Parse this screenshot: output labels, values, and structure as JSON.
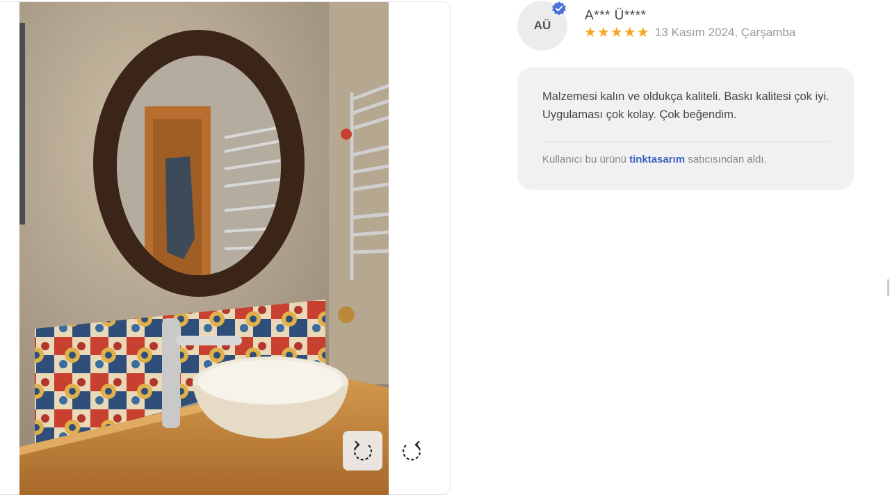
{
  "reviewer": {
    "initials": "AÜ",
    "name": "A*** Ü****",
    "rating": 5,
    "date": "13 Kasım 2024, Çarşamba",
    "verified_icon": "verified-check-badge"
  },
  "review": {
    "text": "Malzemesi kalın ve oldukça kaliteli. Baskı kalitesi çok iyi. Uygulaması çok kolay. Çok beğendim.",
    "seller_prefix": "Kullanıcı bu ürünü",
    "seller_name": "tinktasarım",
    "seller_suffix": "satıcısından aldı."
  },
  "viewer": {
    "photo_subject": "bathroom-mirror-sink-tile-photo",
    "rotate_left_icon": "rotate-left-icon",
    "rotate_right_icon": "rotate-right-icon"
  },
  "colors": {
    "star": "#f5a623",
    "link": "#3c62c2",
    "bubble": "#f1f1f3",
    "verified": "#4a6fd8"
  }
}
